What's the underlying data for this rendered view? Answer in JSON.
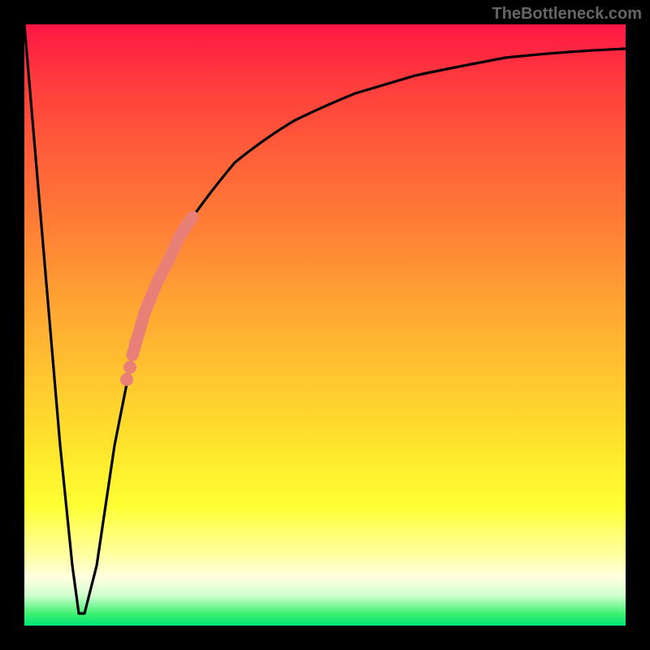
{
  "chart_data": {
    "type": "line",
    "title": "",
    "xlabel": "",
    "ylabel": "",
    "xlim": [
      0,
      100
    ],
    "ylim": [
      0,
      100
    ],
    "x": [
      0,
      3,
      6,
      8,
      9,
      10,
      12,
      15,
      18,
      20,
      22,
      24,
      26,
      30,
      35,
      40,
      45,
      50,
      55,
      60,
      70,
      80,
      90,
      100
    ],
    "values": [
      100,
      65,
      30,
      10,
      2,
      2,
      10,
      30,
      45,
      52,
      57,
      61,
      65,
      71,
      77,
      81,
      84,
      86.5,
      88.5,
      90,
      92,
      93.3,
      94.2,
      95
    ],
    "series": [
      {
        "name": "bottleneck-curve",
        "x": [
          0,
          3,
          6,
          8,
          9,
          10,
          12,
          15,
          18,
          20,
          22,
          24,
          26,
          30,
          35,
          40,
          45,
          50,
          55,
          60,
          70,
          80,
          90,
          100
        ],
        "values": [
          100,
          65,
          30,
          10,
          2,
          2,
          10,
          30,
          45,
          52,
          57,
          61,
          65,
          71,
          77,
          81,
          84,
          86.5,
          88.5,
          90,
          92,
          93.3,
          94.2,
          95
        ]
      },
      {
        "name": "highlighted-segment",
        "x": [
          18,
          20,
          22,
          24,
          26,
          28
        ],
        "values": [
          45,
          52,
          57,
          61,
          65,
          68
        ]
      },
      {
        "name": "highlighted-dots",
        "x": [
          17,
          17.5,
          18.5
        ],
        "values": [
          41,
          43,
          47
        ]
      }
    ],
    "colors": {
      "curve": "#000000",
      "highlight": "#e88078",
      "background_top": "#ff1744",
      "background_mid": "#ffd633",
      "background_bottom": "#00e676"
    }
  },
  "watermark": "TheBottleneck.com"
}
